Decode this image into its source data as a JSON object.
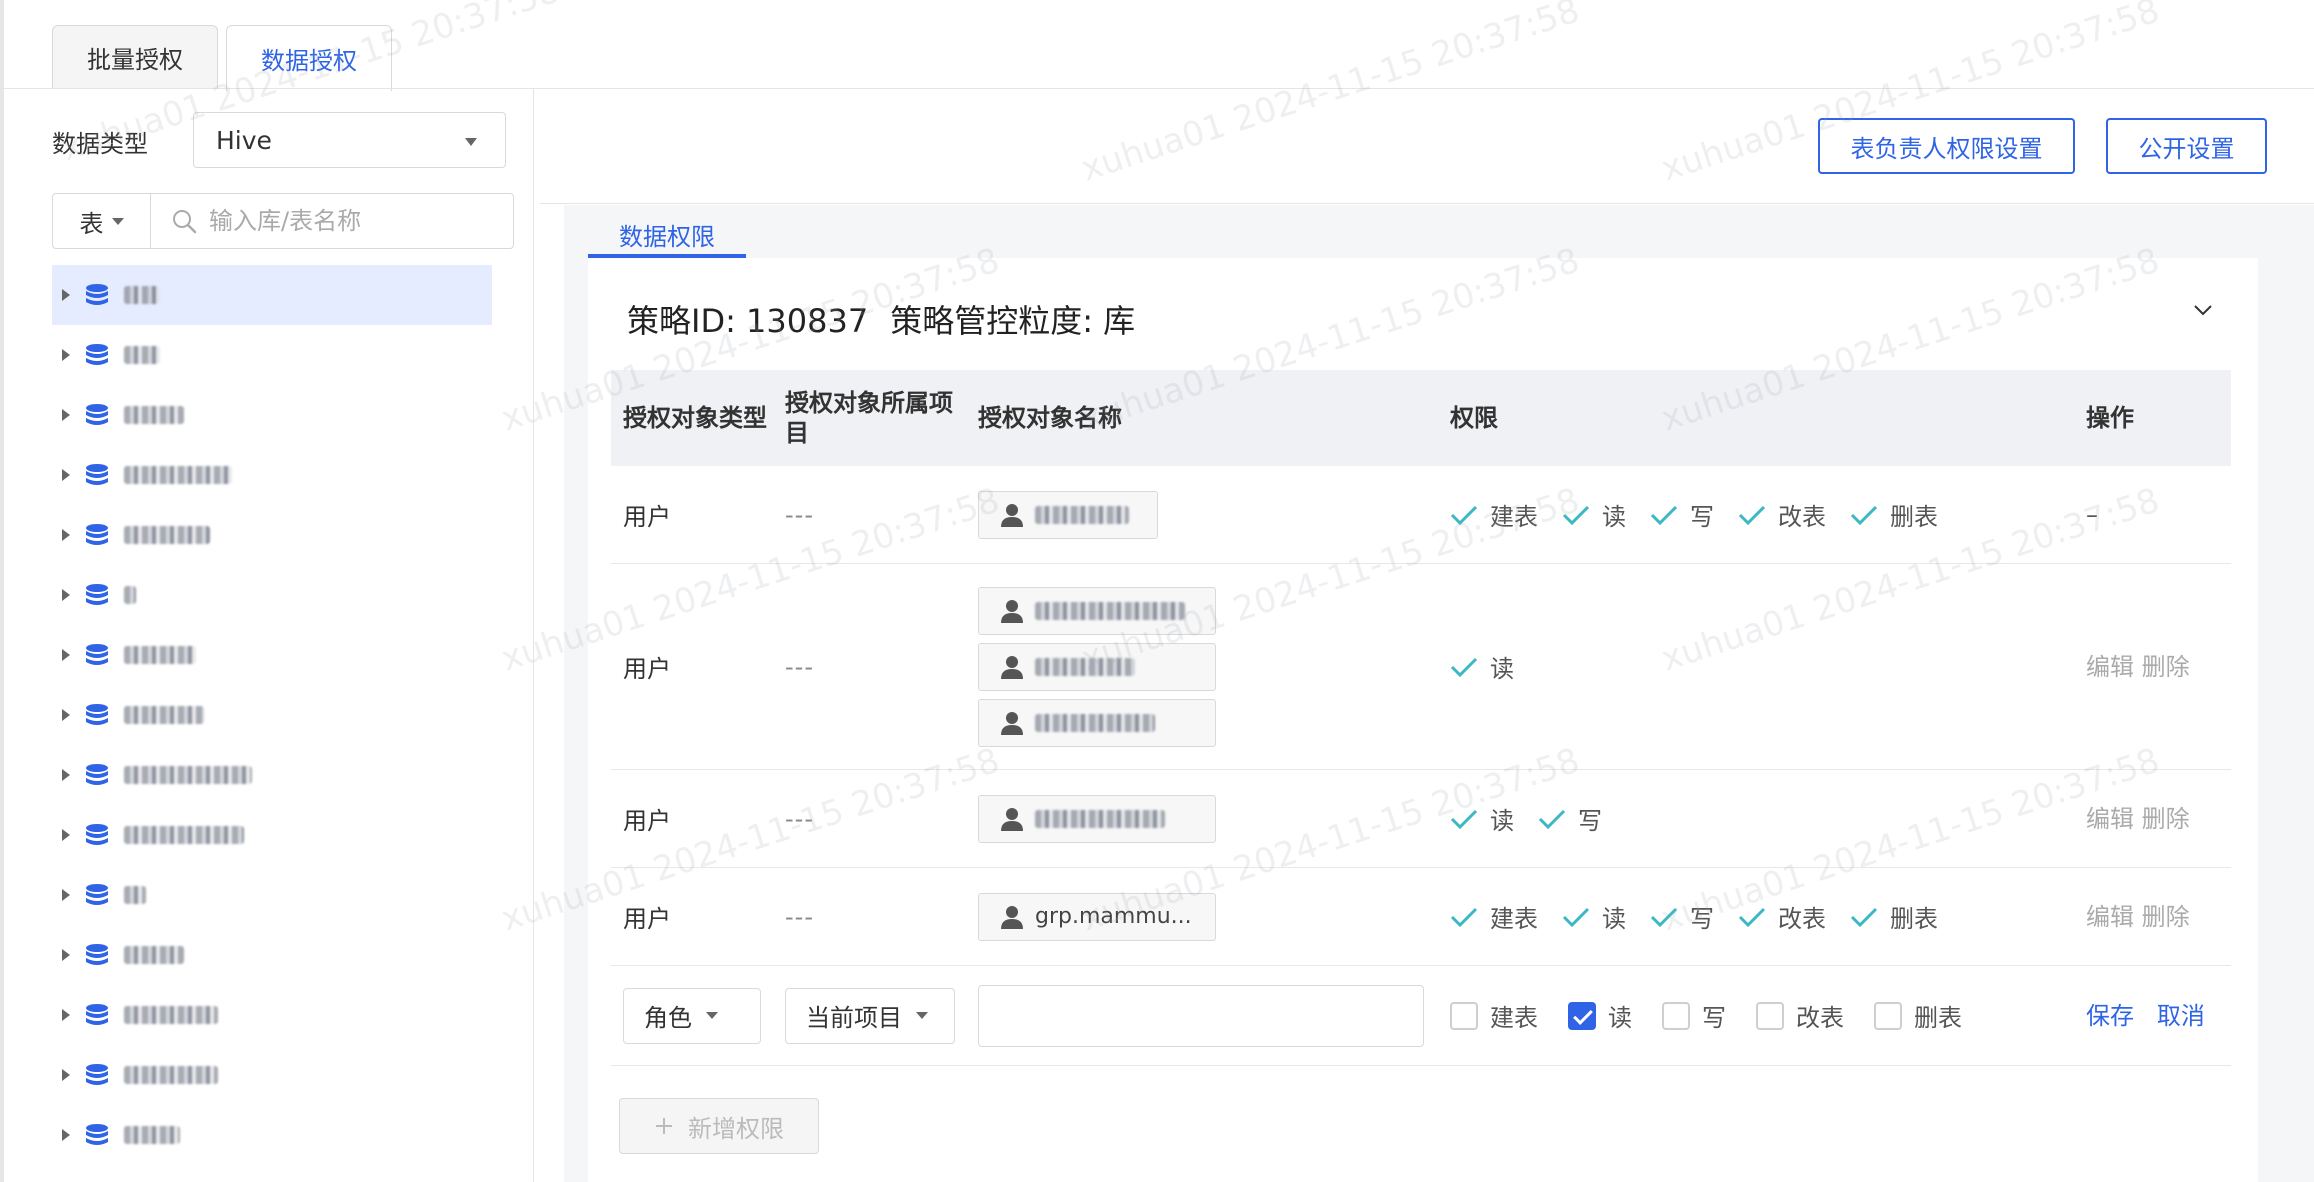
{
  "top_tabs": [
    {
      "label": "批量授权",
      "active": false
    },
    {
      "label": "数据授权",
      "active": true
    }
  ],
  "left": {
    "data_type_label": "数据类型",
    "data_type_value": "Hive",
    "search_type": "表",
    "search_placeholder": "输入库/表名称",
    "tree_items_count": 15
  },
  "buttons": {
    "owner_settings": "表负责人权限设置",
    "public_settings": "公开设置"
  },
  "section_tab": "数据权限",
  "policy": {
    "id_text": "策略ID: 130837",
    "granularity_text": "策略管控粒度: 库"
  },
  "table": {
    "headers": [
      "授权对象类型",
      "授权对象所属项目",
      "授权对象名称",
      "权限",
      "操作"
    ],
    "rows": [
      {
        "type": "用户",
        "project": "---",
        "perms": [
          "建表",
          "读",
          "写",
          "改表",
          "删表"
        ],
        "op": "–"
      },
      {
        "type": "用户",
        "project": "---",
        "perms": [
          "读"
        ],
        "op": "编辑  删除"
      },
      {
        "type": "用户",
        "project": "---",
        "perms": [
          "读",
          "写"
        ],
        "op": "编辑  删除"
      },
      {
        "type": "用户",
        "project": "---",
        "tag_text": "grp.mammu...",
        "perms": [
          "建表",
          "读",
          "写",
          "改表",
          "删表"
        ],
        "op": "编辑  删除"
      }
    ],
    "edit_row": {
      "role_select": "角色",
      "project_select": "当前项目",
      "perm_options": [
        {
          "label": "建表",
          "checked": false
        },
        {
          "label": "读",
          "checked": true
        },
        {
          "label": "写",
          "checked": false
        },
        {
          "label": "改表",
          "checked": false
        },
        {
          "label": "删表",
          "checked": false
        }
      ],
      "save": "保存",
      "cancel": "取消"
    }
  },
  "add_button": "新增权限",
  "watermark_text": "xuhua01 2024-11-15 20:37:58",
  "colors": {
    "accent": "#2f64e6",
    "check": "#3ab8c4"
  }
}
